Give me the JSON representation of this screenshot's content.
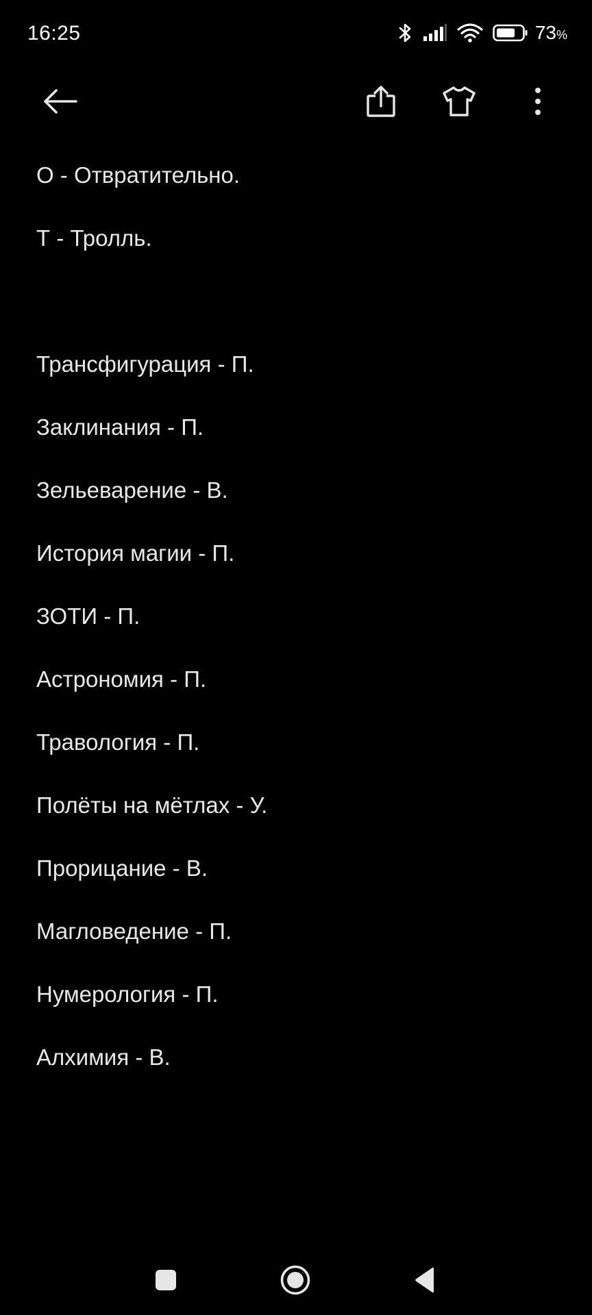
{
  "status_bar": {
    "time": "16:25",
    "battery_percent": "73",
    "battery_unit": "%",
    "icons": [
      "bluetooth-icon",
      "signal-icon",
      "wifi-icon",
      "battery-icon"
    ]
  },
  "toolbar": {
    "icons": [
      "back-arrow-icon",
      "share-icon",
      "tshirt-theme-icon",
      "more-vert-icon"
    ]
  },
  "note": {
    "lines": [
      "О - Отвратительно.",
      "Т - Тролль.",
      "",
      "Трансфигурация - П.",
      "Заклинания - П.",
      "Зельеварение - В.",
      "История магии - П.",
      "ЗОТИ - П.",
      "Астрономия - П.",
      "Травология - П.",
      "Полёты на мётлах - У.",
      "Прорицание - В.",
      "Магловедение - П.",
      "Нумерология - П.",
      "Алхимия - В."
    ]
  },
  "nav_bar": {
    "icons": [
      "recents-square-icon",
      "home-circle-icon",
      "back-triangle-icon"
    ]
  },
  "colors": {
    "background": "#000000",
    "text": "#e8e8e8",
    "icon": "#e6e6e6"
  }
}
